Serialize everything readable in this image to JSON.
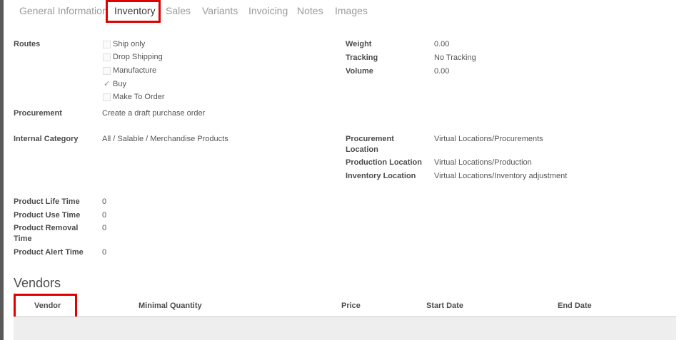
{
  "tabs": [
    {
      "label": "General Information",
      "active": false
    },
    {
      "label": "Inventory",
      "active": true
    },
    {
      "label": "Sales",
      "active": false
    },
    {
      "label": "Variants",
      "active": false
    },
    {
      "label": "Invoicing",
      "active": false
    },
    {
      "label": "Notes",
      "active": false
    },
    {
      "label": "Images",
      "active": false
    }
  ],
  "routes": {
    "label": "Routes",
    "options": [
      {
        "label": "Ship only",
        "checked": false
      },
      {
        "label": "Drop Shipping",
        "checked": false
      },
      {
        "label": "Manufacture",
        "checked": false
      },
      {
        "label": "Buy",
        "checked": true
      },
      {
        "label": "Make To Order",
        "checked": false
      }
    ]
  },
  "weight": {
    "label": "Weight",
    "value": "0.00"
  },
  "tracking": {
    "label": "Tracking",
    "value": "No Tracking"
  },
  "volume": {
    "label": "Volume",
    "value": "0.00"
  },
  "procurement": {
    "label": "Procurement",
    "value": "Create a draft purchase order"
  },
  "internal_category": {
    "label": "Internal Category",
    "value": "All / Salable / Merchandise Products"
  },
  "procurement_location": {
    "label_line1": "Procurement",
    "label_line2": "Location",
    "value": "Virtual Locations/Procurements"
  },
  "production_location": {
    "label": "Production Location",
    "value": "Virtual Locations/Production"
  },
  "inventory_location": {
    "label": "Inventory Location",
    "value": "Virtual Locations/Inventory adjustment"
  },
  "life_time": {
    "label": "Product Life Time",
    "value": "0"
  },
  "use_time": {
    "label": "Product Use Time",
    "value": "0"
  },
  "removal_time": {
    "label_line1": "Product Removal",
    "label_line2": "Time",
    "value": "0"
  },
  "alert_time": {
    "label": "Product Alert Time",
    "value": "0"
  },
  "vendors": {
    "title": "Vendors",
    "columns": [
      "Vendor",
      "Minimal Quantity",
      "Price",
      "Start Date",
      "End Date"
    ]
  },
  "icons": {
    "checkmark": "✓"
  },
  "colors": {
    "highlight": "#e00000",
    "inactive_tab": "#9a9a9a"
  }
}
